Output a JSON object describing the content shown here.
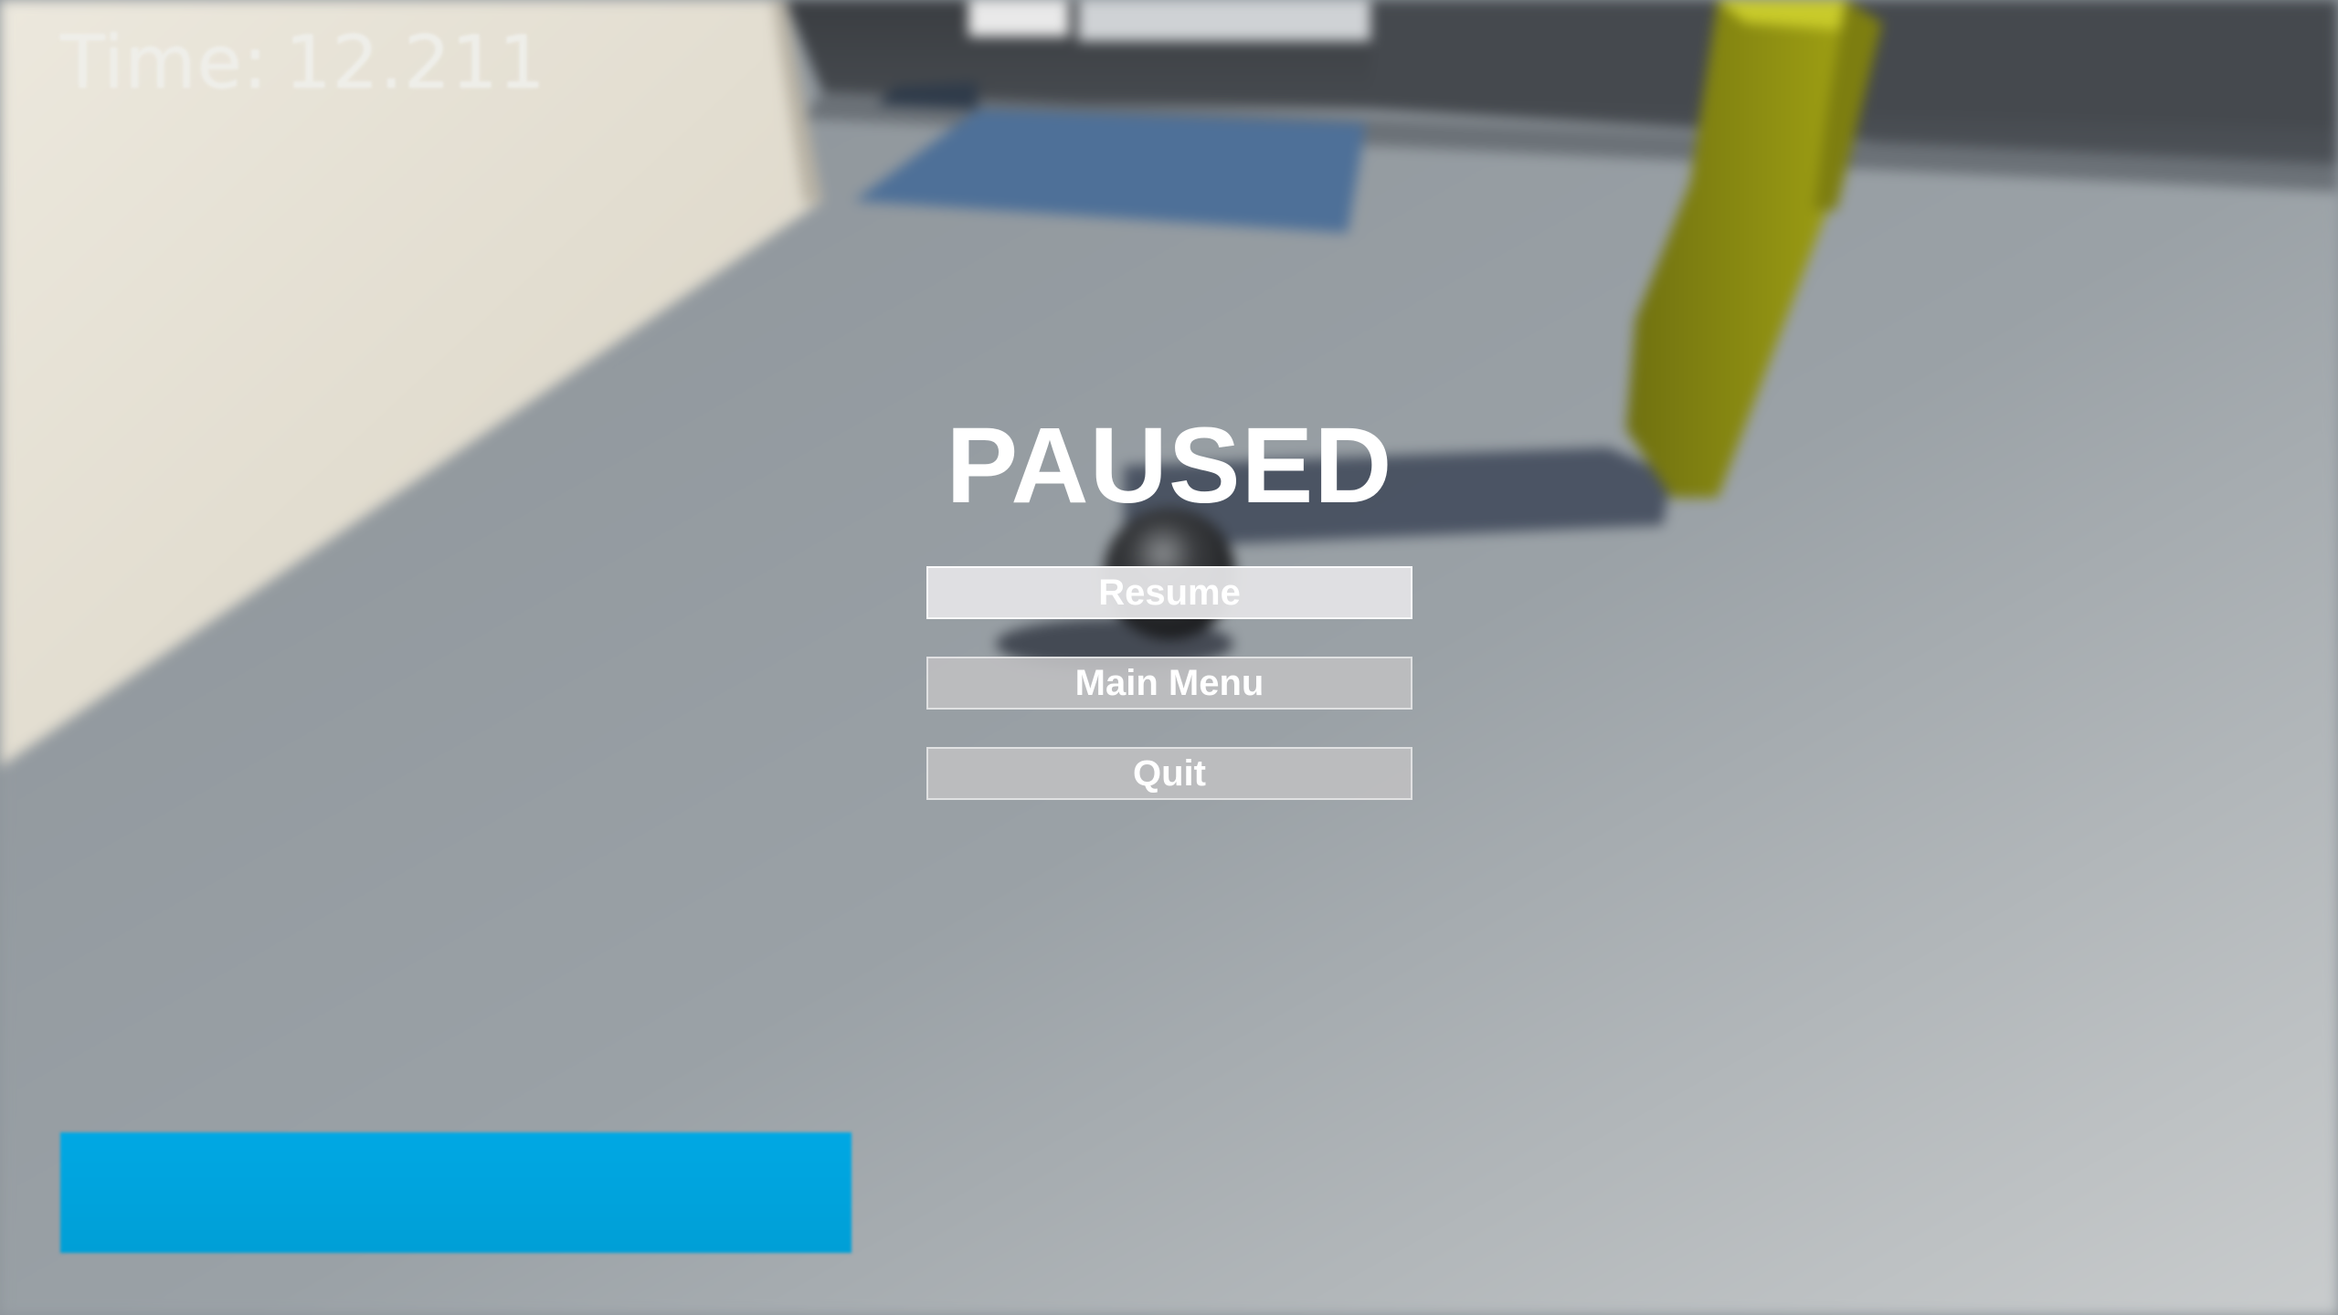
{
  "hud": {
    "timer_label": "Time:",
    "timer_value": "12.211",
    "health_fill_percent": 100,
    "health_color": "#00A4E0"
  },
  "pause_menu": {
    "title": "PAUSED",
    "buttons": [
      {
        "label": "Resume",
        "selected": true
      },
      {
        "label": "Main Menu",
        "selected": false
      },
      {
        "label": "Quit",
        "selected": false
      }
    ]
  },
  "scene": {
    "floor_color": "#9AA0A5",
    "wall_color": "#E4DFD3",
    "pillar_color": "#A9AA14",
    "ball_color": "#2C2E30",
    "window_light_color": "#4E7098"
  }
}
